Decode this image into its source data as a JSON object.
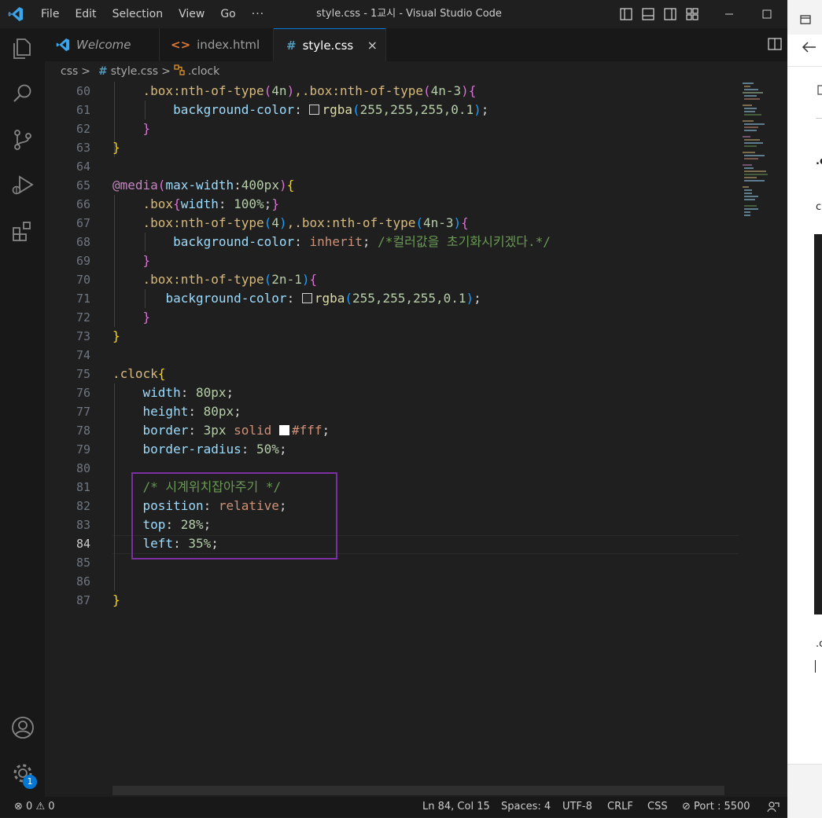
{
  "menu": [
    "File",
    "Edit",
    "Selection",
    "View",
    "Go"
  ],
  "menu_more": "···",
  "window_title": "style.css - 1교시 - Visual Studio Code",
  "tabs": [
    {
      "label": "Welcome",
      "icon": "vscode-icon"
    },
    {
      "label": "index.html",
      "icon": "html-code-icon"
    },
    {
      "label": "style.css",
      "icon": "hash-icon"
    }
  ],
  "tab_close": "×",
  "breadcrumb": {
    "folder": "css",
    "sep": ">",
    "file_icon": "#",
    "file": "style.css",
    "symbol": ".clock"
  },
  "line_numbers": [
    "60",
    "61",
    "62",
    "63",
    "64",
    "65",
    "66",
    "67",
    "68",
    "69",
    "70",
    "71",
    "72",
    "73",
    "74",
    "75",
    "76",
    "77",
    "78",
    "79",
    "80",
    "81",
    "82",
    "83",
    "84",
    "85",
    "86",
    "87"
  ],
  "code": {
    "l60a": ".box",
    "l60b": ":nth-of-type",
    "l60c": "(",
    "l60d": "4n",
    "l60e": ")",
    "l60f": ",.box",
    "l60g": ":nth-of-type",
    "l60h": "(",
    "l60i": "4n-3",
    "l60j": ")",
    "l60k": "{",
    "l61a": "background-color",
    "l61b": ": ",
    "l61c": "rgba",
    "l61d": "(",
    "l61e": "255,255,255,0.1",
    "l61f": ")",
    "l61g": ";",
    "l62": "}",
    "l63": "}",
    "l65a": "@media",
    "l65b": "(",
    "l65c": "max-width",
    "l65d": ":",
    "l65e": "400px",
    "l65f": ")",
    "l65g": "{",
    "l66a": ".box",
    "l66b": "{",
    "l66c": "width",
    "l66d": ": ",
    "l66e": "100%",
    "l66f": ";",
    "l66g": "}",
    "l67a": ".box",
    "l67b": ":nth-of-type",
    "l67c": "(",
    "l67d": "4",
    "l67e": ")",
    "l67f": ",.box",
    "l67g": ":nth-of-type",
    "l67h": "(",
    "l67i": "4n-3",
    "l67j": ")",
    "l67k": "{",
    "l68a": "background-color",
    "l68b": ": ",
    "l68c": "inherit",
    "l68d": "; ",
    "l68e": "/*컬러값을 초기화시키겠다.*/",
    "l69": "}",
    "l70a": ".box",
    "l70b": ":nth-of-type",
    "l70c": "(",
    "l70d": "2n-1",
    "l70e": ")",
    "l70f": "{",
    "l71a": "background-color",
    "l71b": ": ",
    "l71c": "rgba",
    "l71d": "(",
    "l71e": "255,255,255,0.1",
    "l71f": ")",
    "l71g": ";",
    "l72": "}",
    "l73": "}",
    "l75a": ".clock",
    "l75b": "{",
    "l76a": "width",
    "l76b": ": ",
    "l76c": "80px",
    "l76d": ";",
    "l77a": "height",
    "l77b": ": ",
    "l77c": "80px",
    "l77d": ";",
    "l78a": "border",
    "l78b": ": ",
    "l78c": "3px",
    "l78d": " solid ",
    "l78e": "#fff",
    "l78f": ";",
    "l79a": "border-radius",
    "l79b": ": ",
    "l79c": "50%",
    "l79d": ";",
    "l81": "/* 시계위치잡아주기 */",
    "l82a": "position",
    "l82b": ": ",
    "l82c": "relative",
    "l82d": ";",
    "l83a": "top",
    "l83b": ": ",
    "l83c": "28%",
    "l83d": ";",
    "l84a": "left",
    "l84b": ": ",
    "l84c": "35%",
    "l84d": ";",
    "l87": "}"
  },
  "status": {
    "errors": "0",
    "warnings": "0",
    "position": "Ln 84, Col 15",
    "spaces": "Spaces: 4",
    "encoding": "UTF-8",
    "eol": "CRLF",
    "language": "CSS",
    "port": "Port : 5500"
  },
  "settings_badge": "1",
  "side_panel": {
    "t1": "c",
    "t2": ".c",
    "t3": ".c"
  },
  "colors": {
    "accent": "#0078d4",
    "highlight_box": "#7b2fa0",
    "badge": "#0078d4"
  }
}
